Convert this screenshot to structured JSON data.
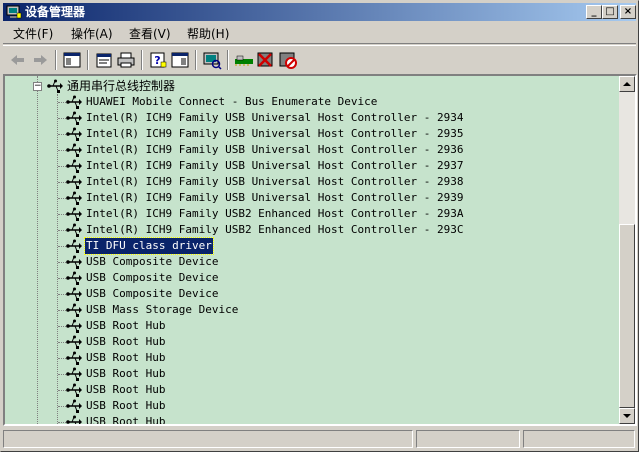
{
  "window": {
    "title": "设备管理器",
    "controls": {
      "minimize": "_",
      "maximize": "□",
      "close": "×"
    }
  },
  "menu": [
    {
      "label": "文件(F)"
    },
    {
      "label": "操作(A)"
    },
    {
      "label": "查看(V)"
    },
    {
      "label": "帮助(H)"
    }
  ],
  "toolbar": {
    "buttons": [
      {
        "icon": "back-arrow-icon"
      },
      {
        "icon": "forward-arrow-icon"
      },
      {
        "icon": "show-hide-console-tree-icon"
      },
      {
        "icon": "properties-icon"
      },
      {
        "icon": "print-icon"
      },
      {
        "icon": "help-icon"
      },
      {
        "icon": "show-hide-action-pane-icon"
      },
      {
        "icon": "scan-hardware-icon"
      },
      {
        "icon": "update-driver-icon"
      },
      {
        "icon": "uninstall-icon"
      },
      {
        "icon": "disable-device-icon"
      }
    ]
  },
  "tree": {
    "category": "通用串行总线控制器",
    "category_expander": "−",
    "selected_index": 9,
    "devices": [
      {
        "label": "HUAWEI Mobile Connect - Bus Enumerate Device"
      },
      {
        "label": "Intel(R) ICH9 Family USB Universal Host Controller - 2934"
      },
      {
        "label": "Intel(R) ICH9 Family USB Universal Host Controller - 2935"
      },
      {
        "label": "Intel(R) ICH9 Family USB Universal Host Controller - 2936"
      },
      {
        "label": "Intel(R) ICH9 Family USB Universal Host Controller - 2937"
      },
      {
        "label": "Intel(R) ICH9 Family USB Universal Host Controller - 2938"
      },
      {
        "label": "Intel(R) ICH9 Family USB Universal Host Controller - 2939"
      },
      {
        "label": "Intel(R) ICH9 Family USB2 Enhanced Host Controller - 293A"
      },
      {
        "label": "Intel(R) ICH9 Family USB2 Enhanced Host Controller - 293C"
      },
      {
        "label": "TI DFU class driver"
      },
      {
        "label": "USB Composite Device"
      },
      {
        "label": "USB Composite Device"
      },
      {
        "label": "USB Composite Device"
      },
      {
        "label": "USB Mass Storage Device"
      },
      {
        "label": "USB Root Hub"
      },
      {
        "label": "USB Root Hub"
      },
      {
        "label": "USB Root Hub"
      },
      {
        "label": "USB Root Hub"
      },
      {
        "label": "USB Root Hub"
      },
      {
        "label": "USB Root Hub"
      },
      {
        "label": "USB Root Hub"
      }
    ]
  },
  "scrollbar": {
    "up": "▲",
    "down": "▼"
  },
  "status": {
    "panels": [
      "",
      "",
      ""
    ]
  },
  "colors": {
    "tree_background": "#c6e3cc",
    "selection": "#0a246a",
    "titlebar_start": "#0a246a",
    "titlebar_end": "#a6caf0"
  }
}
